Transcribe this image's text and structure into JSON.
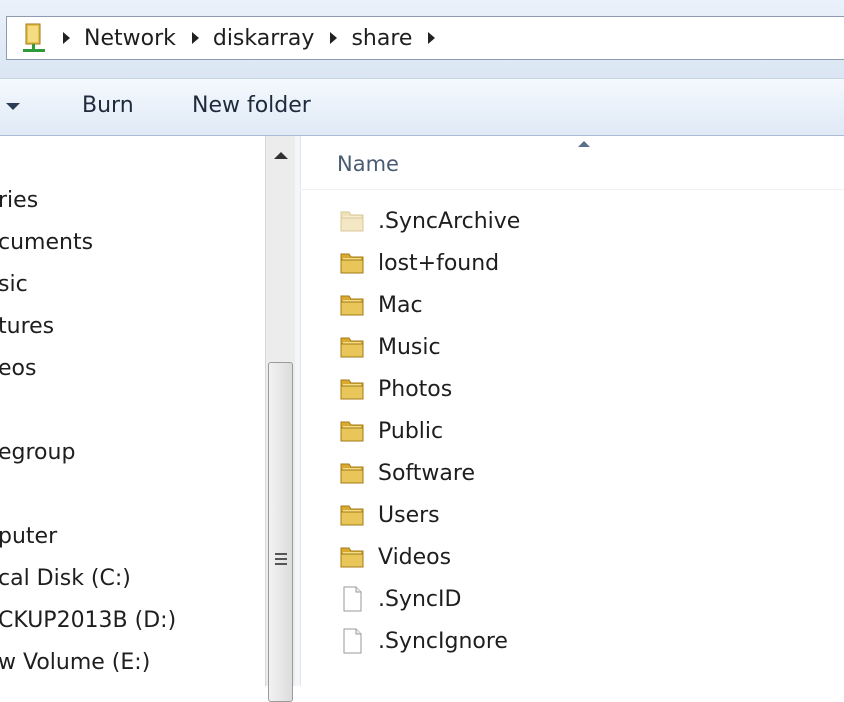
{
  "address_bar": {
    "breadcrumbs": [
      "Network",
      "diskarray",
      "share"
    ]
  },
  "toolbar": {
    "burn_label": "Burn",
    "new_folder_label": "New folder"
  },
  "nav_pane": {
    "items": [
      "ries",
      "cuments",
      "sic",
      "tures",
      "eos",
      "egroup",
      "puter",
      "cal Disk (C:)",
      "CKUP2013B (D:)",
      "w Volume (E:)"
    ]
  },
  "file_list": {
    "column_header": "Name",
    "items": [
      {
        "name": ".SyncArchive",
        "type": "folder-faded"
      },
      {
        "name": "lost+found",
        "type": "folder"
      },
      {
        "name": "Mac",
        "type": "folder"
      },
      {
        "name": "Music",
        "type": "folder"
      },
      {
        "name": "Photos",
        "type": "folder"
      },
      {
        "name": "Public",
        "type": "folder"
      },
      {
        "name": "Software",
        "type": "folder"
      },
      {
        "name": "Users",
        "type": "folder"
      },
      {
        "name": "Videos",
        "type": "folder"
      },
      {
        "name": ".SyncID",
        "type": "file"
      },
      {
        "name": ".SyncIgnore",
        "type": "file"
      }
    ]
  },
  "colors": {
    "toolbar_text": "#1e2b3c",
    "header_text": "#4a5c74",
    "folder_yellow": "#e8c65a"
  }
}
